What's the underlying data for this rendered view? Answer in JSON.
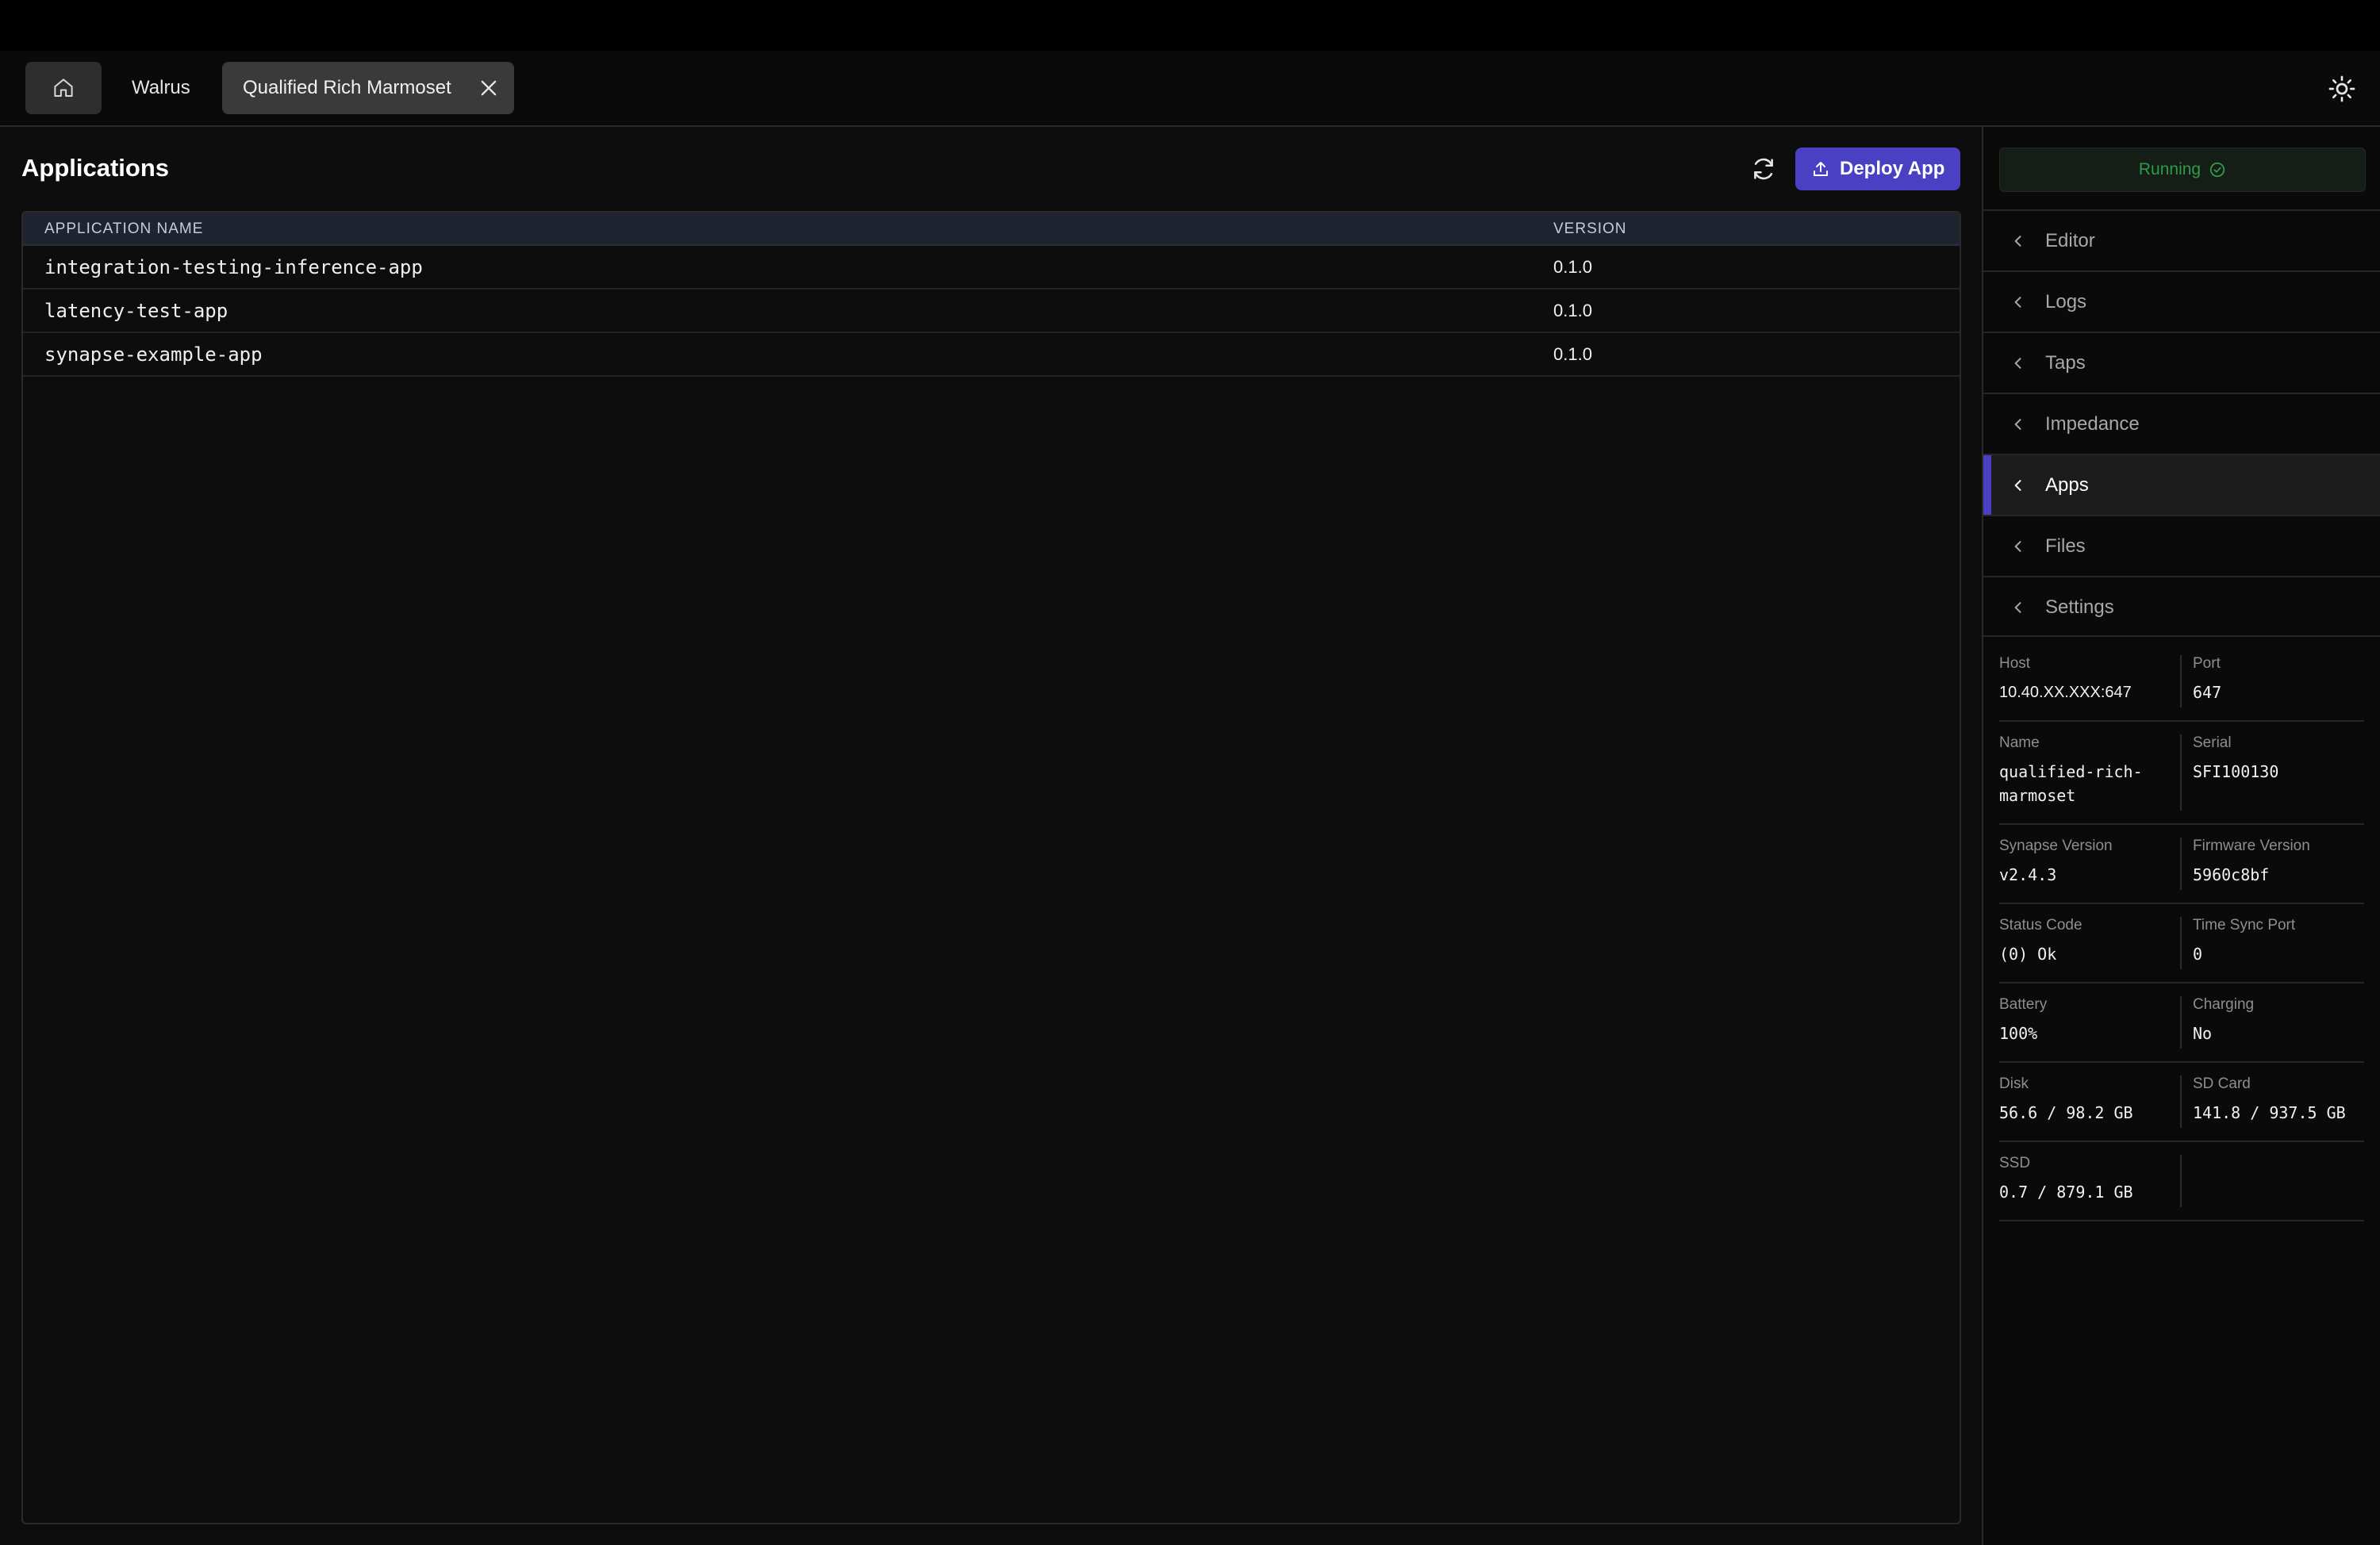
{
  "tabs": {
    "home_icon": "home-icon",
    "items": [
      {
        "label": "Walrus"
      },
      {
        "label": "Qualified Rich Marmoset"
      }
    ]
  },
  "main": {
    "title": "Applications",
    "deploy_label": "Deploy App",
    "table": {
      "headers": {
        "name": "APPLICATION NAME",
        "version": "VERSION"
      },
      "rows": [
        {
          "name": "integration-testing-inference-app",
          "version": "0.1.0"
        },
        {
          "name": "latency-test-app",
          "version": "0.1.0"
        },
        {
          "name": "synapse-example-app",
          "version": "0.1.0"
        }
      ]
    }
  },
  "sidebar": {
    "status": "Running",
    "nav": [
      {
        "label": "Editor"
      },
      {
        "label": "Logs"
      },
      {
        "label": "Taps"
      },
      {
        "label": "Impedance"
      },
      {
        "label": "Apps"
      },
      {
        "label": "Files"
      },
      {
        "label": "Settings"
      }
    ],
    "active_nav": "Apps",
    "info": {
      "host": {
        "label": "Host",
        "value": "10.40.XX.XXX:647"
      },
      "port": {
        "label": "Port",
        "value": "647"
      },
      "name": {
        "label": "Name",
        "value": "qualified-rich-marmoset"
      },
      "serial": {
        "label": "Serial",
        "value": "SFI100130"
      },
      "synapse_version": {
        "label": "Synapse Version",
        "value": "v2.4.3"
      },
      "firmware_version": {
        "label": "Firmware Version",
        "value": "5960c8bf"
      },
      "status_code": {
        "label": "Status Code",
        "value": "(0) Ok"
      },
      "time_sync_port": {
        "label": "Time Sync Port",
        "value": "0"
      },
      "battery": {
        "label": "Battery",
        "value": "100%"
      },
      "charging": {
        "label": "Charging",
        "value": "No"
      },
      "disk": {
        "label": "Disk",
        "value": "56.6 / 98.2 GB"
      },
      "sd_card": {
        "label": "SD Card",
        "value": "141.8 / 937.5 GB"
      },
      "ssd": {
        "label": "SSD",
        "value": "0.7 / 879.1 GB"
      }
    }
  },
  "colors": {
    "accent": "#4a40c4",
    "running": "#2f9b4a",
    "background": "#0d0d0d"
  }
}
